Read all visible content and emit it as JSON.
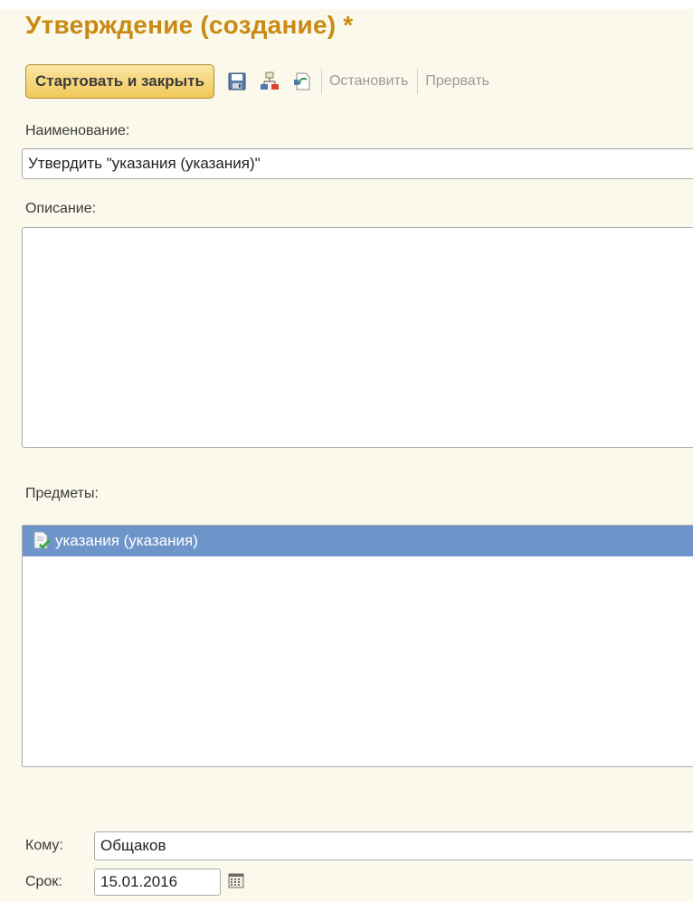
{
  "window": {
    "title": "Утверждение (создание) *"
  },
  "toolbar": {
    "start_close_label": "Стартовать и закрыть",
    "icons": [
      "save-icon",
      "flowchart-icon",
      "refresh-document-icon"
    ],
    "stop_label": "Остановить",
    "abort_label": "Прервать"
  },
  "form": {
    "name_label": "Наименование:",
    "name_value": "Утвердить \"указания (указания)\"",
    "description_label": "Описание:",
    "description_value": "",
    "subjects_label": "Предметы:",
    "subjects": [
      {
        "icon": "document-check-icon",
        "text": "указания (указания)",
        "selected": true
      }
    ],
    "to_label": "Кому:",
    "to_value": "Общаков",
    "deadline_label": "Срок:",
    "deadline_value": "15.01.2016"
  },
  "colors": {
    "background": "#fbf9eb",
    "title": "#c98a13",
    "button_accent": "#f2c85a",
    "selection": "#6e95c9"
  }
}
